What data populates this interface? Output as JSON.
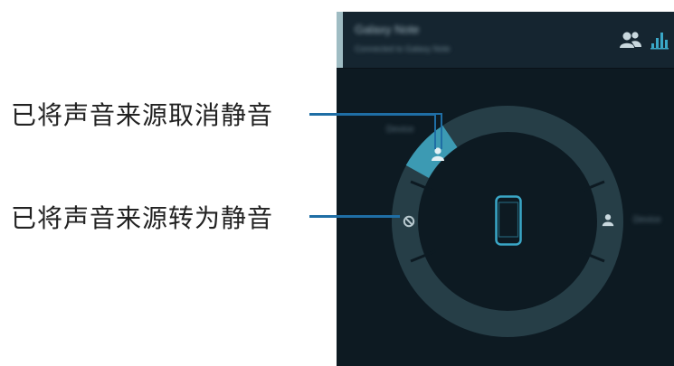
{
  "callouts": {
    "unmute": "已将声音来源取消静音",
    "mute": "已将声音来源转为静音"
  },
  "header": {
    "title": "Galaxy Note",
    "subtitle": "Connected to Galaxy Note",
    "icons": [
      "group-icon",
      "equalizer-icon"
    ]
  },
  "devices": {
    "left_label": "Device",
    "right_label": "Device",
    "center": "phone-icon"
  },
  "colors": {
    "background": "#0d1a22",
    "ring": "#263e47",
    "ring_active": "#3c9ab3",
    "leader": "#1f6ea5"
  }
}
